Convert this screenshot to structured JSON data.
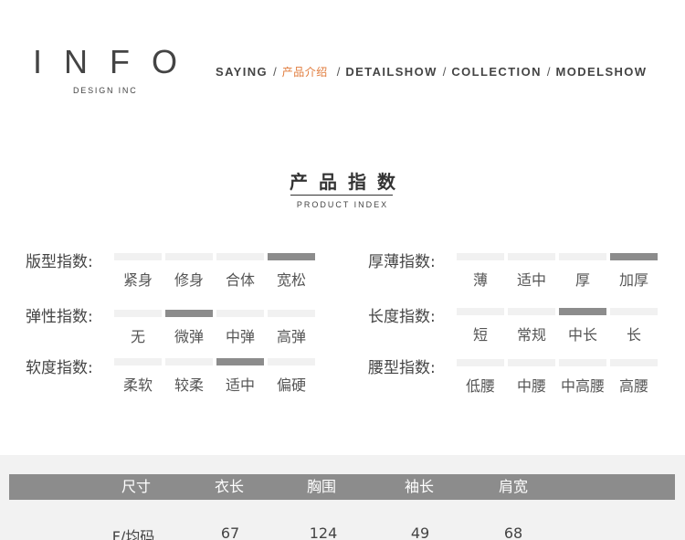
{
  "brand": {
    "title": "INFO",
    "subtitle": "DESIGN INC"
  },
  "nav": {
    "items": [
      {
        "label": "SAYING",
        "active": false
      },
      {
        "label": "产品介绍",
        "active": true
      },
      {
        "label": "DETAILSHOW",
        "active": false
      },
      {
        "label": "COLLECTION",
        "active": false
      },
      {
        "label": "MODELSHOW",
        "active": false
      }
    ],
    "separator": "/"
  },
  "section": {
    "title": "产品指数",
    "subtitle": "PRODUCT INDEX"
  },
  "indexes": {
    "fit": {
      "label": "版型指数:",
      "options": [
        "紧身",
        "修身",
        "合体",
        "宽松"
      ],
      "selected": 3
    },
    "thickness": {
      "label": "厚薄指数:",
      "options": [
        "薄",
        "适中",
        "厚",
        "加厚"
      ],
      "selected": 3
    },
    "elasticity": {
      "label": "弹性指数:",
      "options": [
        "无",
        "微弹",
        "中弹",
        "高弹"
      ],
      "selected": 1
    },
    "length": {
      "label": "长度指数:",
      "options": [
        "短",
        "常规",
        "中长",
        "长"
      ],
      "selected": 2
    },
    "softness": {
      "label": "软度指数:",
      "options": [
        "柔软",
        "较柔",
        "适中",
        "偏硬"
      ],
      "selected": 2
    },
    "waist": {
      "label": "腰型指数:",
      "options": [
        "低腰",
        "中腰",
        "中高腰",
        "高腰"
      ],
      "selected": null
    }
  },
  "size_table": {
    "headers": [
      "尺寸",
      "衣长",
      "胸围",
      "袖长",
      "肩宽"
    ],
    "rows": [
      [
        "F/均码",
        "67",
        "124",
        "49",
        "68"
      ]
    ]
  },
  "colors": {
    "accent": "#e07a3a",
    "bar_on": "#8c8c8c",
    "bar_off": "#f1f1f1",
    "table_header": "#8c8c8c"
  }
}
